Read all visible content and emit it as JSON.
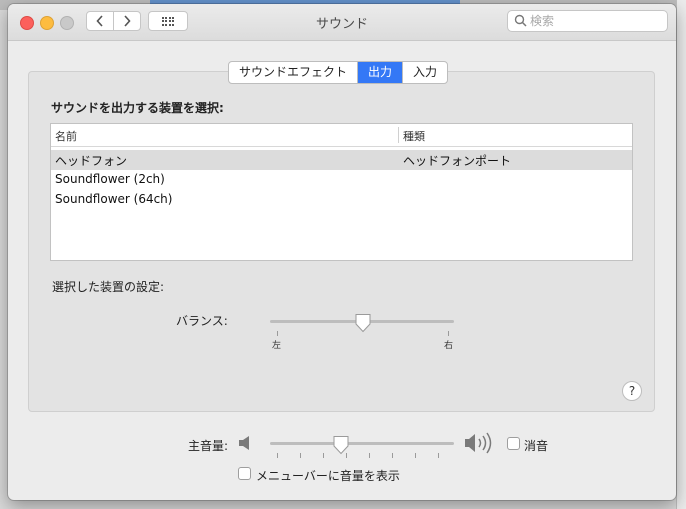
{
  "window": {
    "title": "サウンド",
    "search_placeholder": "検索"
  },
  "tabs": [
    {
      "label": "サウンドエフェクト",
      "active": false
    },
    {
      "label": "出力",
      "active": true
    },
    {
      "label": "入力",
      "active": false
    }
  ],
  "output": {
    "section_label": "サウンドを出力する装置を選択:",
    "columns": [
      "名前",
      "種類"
    ],
    "devices": [
      {
        "name": "ヘッドフォン",
        "type": "ヘッドフォンポート",
        "selected": true
      },
      {
        "name": "Soundflower (2ch)",
        "type": "",
        "selected": false
      },
      {
        "name": "Soundflower (64ch)",
        "type": "",
        "selected": false
      }
    ],
    "settings_label": "選択した装置の設定:",
    "balance": {
      "label": "バランス:",
      "left_label": "左",
      "right_label": "右",
      "value": 0.5
    }
  },
  "volume": {
    "label": "主音量:",
    "value": 0.38,
    "mute_label": "消音",
    "mute_checked": false,
    "menubar_label": "メニューバーに音量を表示",
    "menubar_checked": false
  },
  "help_label": "?",
  "colors": {
    "accent": "#3478f6",
    "window_bg": "#ececec",
    "selection": "#dcdcdc"
  },
  "icons": [
    "chevron-left-icon",
    "chevron-right-icon",
    "grid-icon",
    "search-icon",
    "speaker-low-icon",
    "speaker-high-icon",
    "slider-knob-icon"
  ]
}
